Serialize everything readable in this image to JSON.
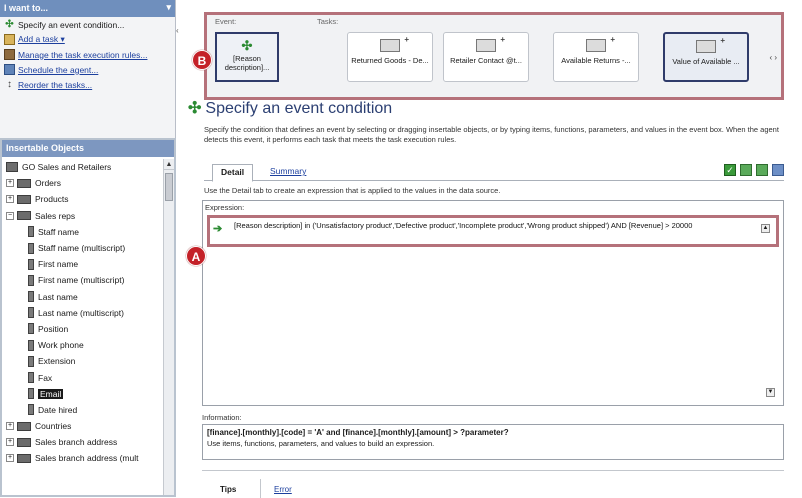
{
  "left_pane": {
    "header": "I want to...",
    "pin": "▾",
    "tasks": [
      {
        "label": "Specify an event condition...",
        "icon": "event-condition-icon",
        "link": false
      },
      {
        "label": "Add a task ▾",
        "icon": "add-task-icon",
        "link": true
      },
      {
        "label": "Manage the task execution rules...",
        "icon": "task-execution-icon",
        "link": true
      },
      {
        "label": "Schedule the agent...",
        "icon": "schedule-icon",
        "link": true
      },
      {
        "label": "Reorder the tasks...",
        "icon": "reorder-icon",
        "link": true
      }
    ],
    "tree_header": "Insertable Objects",
    "tree": [
      {
        "label": "GO Sales and Retailers",
        "kind": "root"
      },
      {
        "label": "Orders",
        "kind": "folder",
        "exp": "+"
      },
      {
        "label": "Products",
        "kind": "folder",
        "exp": "+"
      },
      {
        "label": "Sales reps",
        "kind": "folder",
        "exp": "−"
      },
      {
        "label": "Staff name",
        "kind": "column"
      },
      {
        "label": "Staff name (multiscript)",
        "kind": "column"
      },
      {
        "label": "First name",
        "kind": "column"
      },
      {
        "label": "First name (multiscript)",
        "kind": "column"
      },
      {
        "label": "Last name",
        "kind": "column"
      },
      {
        "label": "Last name (multiscript)",
        "kind": "column"
      },
      {
        "label": "Position",
        "kind": "column"
      },
      {
        "label": "Work phone",
        "kind": "column"
      },
      {
        "label": "Extension",
        "kind": "column"
      },
      {
        "label": "Fax",
        "kind": "column"
      },
      {
        "label": "Email",
        "kind": "column",
        "selected": true
      },
      {
        "label": "Date hired",
        "kind": "column"
      },
      {
        "label": "Countries",
        "kind": "folder",
        "exp": "+"
      },
      {
        "label": "Sales branch address",
        "kind": "folder",
        "exp": "+"
      },
      {
        "label": "Sales branch address (mult",
        "kind": "folder",
        "exp": "+"
      }
    ]
  },
  "toolbar": {
    "event_label": "Event:",
    "tasks_label": "Tasks:",
    "event_card": "[Reason description]...",
    "tasks": [
      {
        "label": "Returned Goods - De..."
      },
      {
        "label": "Retailer Contact @t..."
      },
      {
        "label": "Available Returns -..."
      },
      {
        "label": "Value of Available ..."
      }
    ]
  },
  "badges": {
    "a": "A",
    "b": "B"
  },
  "main": {
    "title": "Specify an event condition",
    "description": "Specify the condition that defines an event by selecting or dragging insertable objects, or by typing items, functions, parameters, and values in the event box. When the agent detects this event, it performs each task that meets the task execution rules.",
    "tabs": [
      {
        "label": "Detail"
      },
      {
        "label": "Summary"
      }
    ],
    "tab_hint": "Use the Detail tab to create an expression that is applied to the values in the data source.",
    "expression_label": "Expression:",
    "expression": "[Reason description] in ('Unsatisfactory product','Defective product','Incomplete product','Wrong product shipped') AND [Revenue] > 20000",
    "information_label": "Information:",
    "info_expression": "[finance].[monthly].[code] = 'A' and [finance].[monthly].[amount] > ?parameter?",
    "info_description": "Use items, functions, parameters, and values to build an expression.",
    "tips_label": "Tips",
    "tips_link": "Error"
  }
}
